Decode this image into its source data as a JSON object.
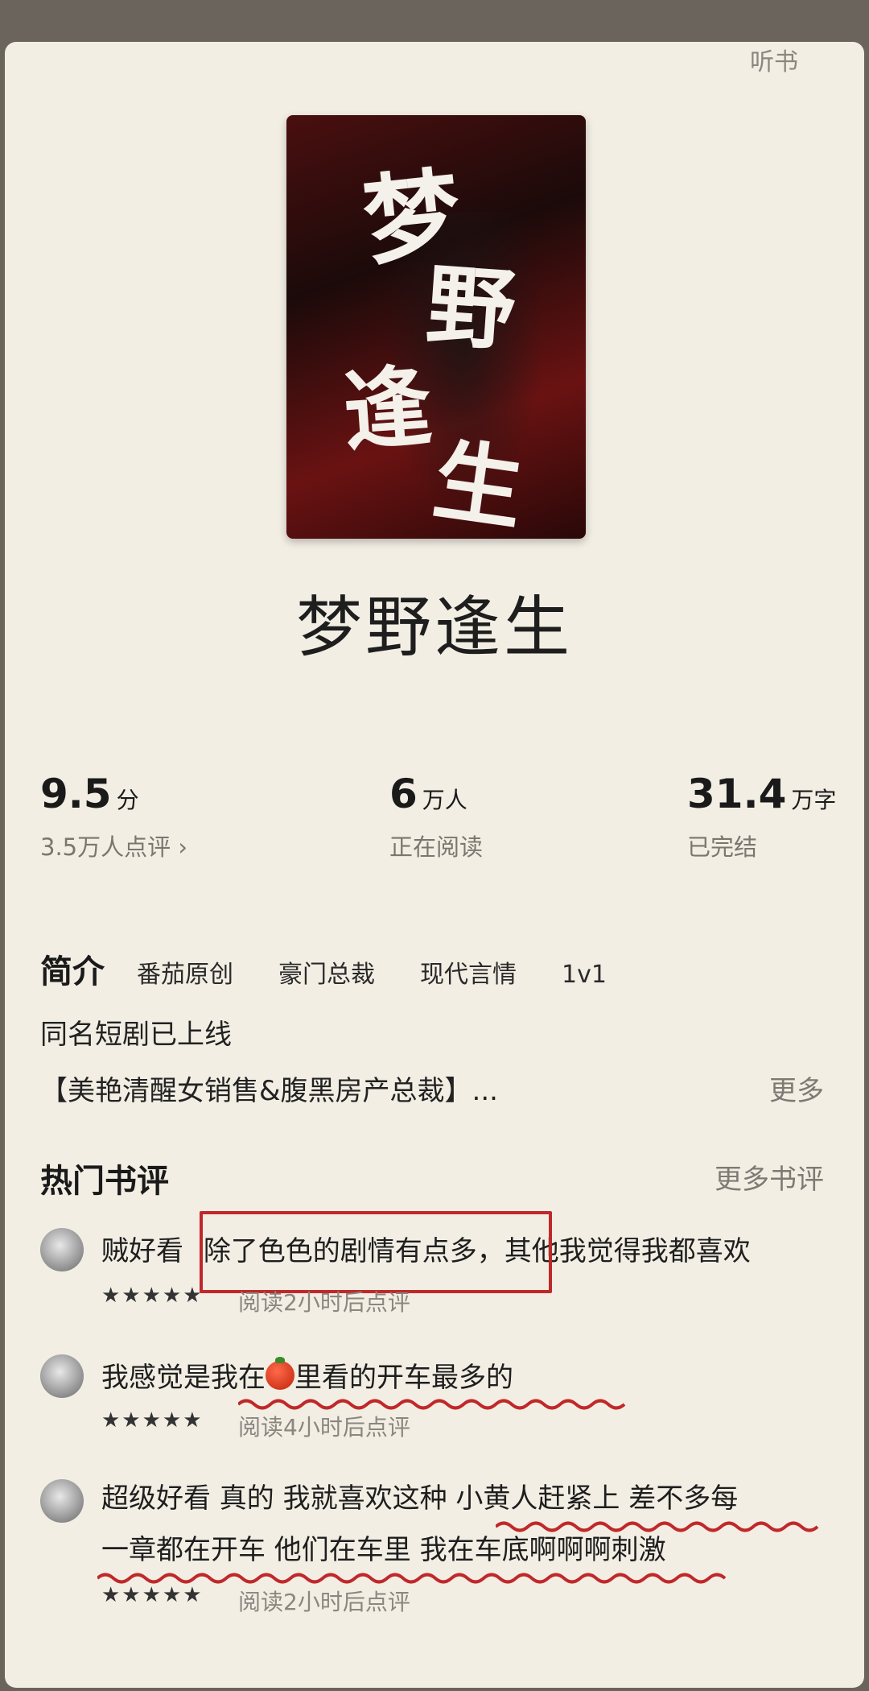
{
  "header": {
    "listen_label": "听书"
  },
  "book": {
    "cover_title": "梦野逢生",
    "cover_chars": [
      "梦",
      "野",
      "逢",
      "生"
    ],
    "title": "梦野逢生"
  },
  "stats": {
    "score": {
      "value": "9.5",
      "unit": "分",
      "sub": "3.5万人点评 ›"
    },
    "readers": {
      "value": "6",
      "unit": "万人",
      "sub": "正在阅读"
    },
    "words": {
      "value": "31.4",
      "unit": "万字",
      "sub": "已完结"
    }
  },
  "intro": {
    "heading": "简介",
    "tags": [
      "番茄原创",
      "豪门总裁",
      "现代言情",
      "1v1"
    ],
    "line1": "同名短剧已上线",
    "line2": "【美艳清醒女销售&腹黑房产总裁】...",
    "more_label": "更多"
  },
  "reviews_section": {
    "heading": "热门书评",
    "more_label": "更多书评",
    "reviews": [
      {
        "text_a": "贼好看 ",
        "highlight": "除了色色的剧情有点多，",
        "text_b": "其他我觉得我都喜欢",
        "stars": "★★★★★",
        "meta": "阅读2小时后点评"
      },
      {
        "text_a": "我感觉是我在",
        "icon": "tomato-icon",
        "text_b": "里看的开车最多的",
        "stars": "★★★★★",
        "meta": "阅读4小时后点评"
      },
      {
        "line1": "超级好看 真的 我就喜欢这种 小黄人赶紧上 差不多每",
        "line2": "一章都在开车 他们在车里 我在车底啊啊啊刺激",
        "stars": "★★★★★",
        "meta": "阅读2小时后点评"
      }
    ]
  },
  "colors": {
    "background": "#f2eee4",
    "highlight_red": "#c0282a",
    "cover_red": "#6a1212"
  }
}
